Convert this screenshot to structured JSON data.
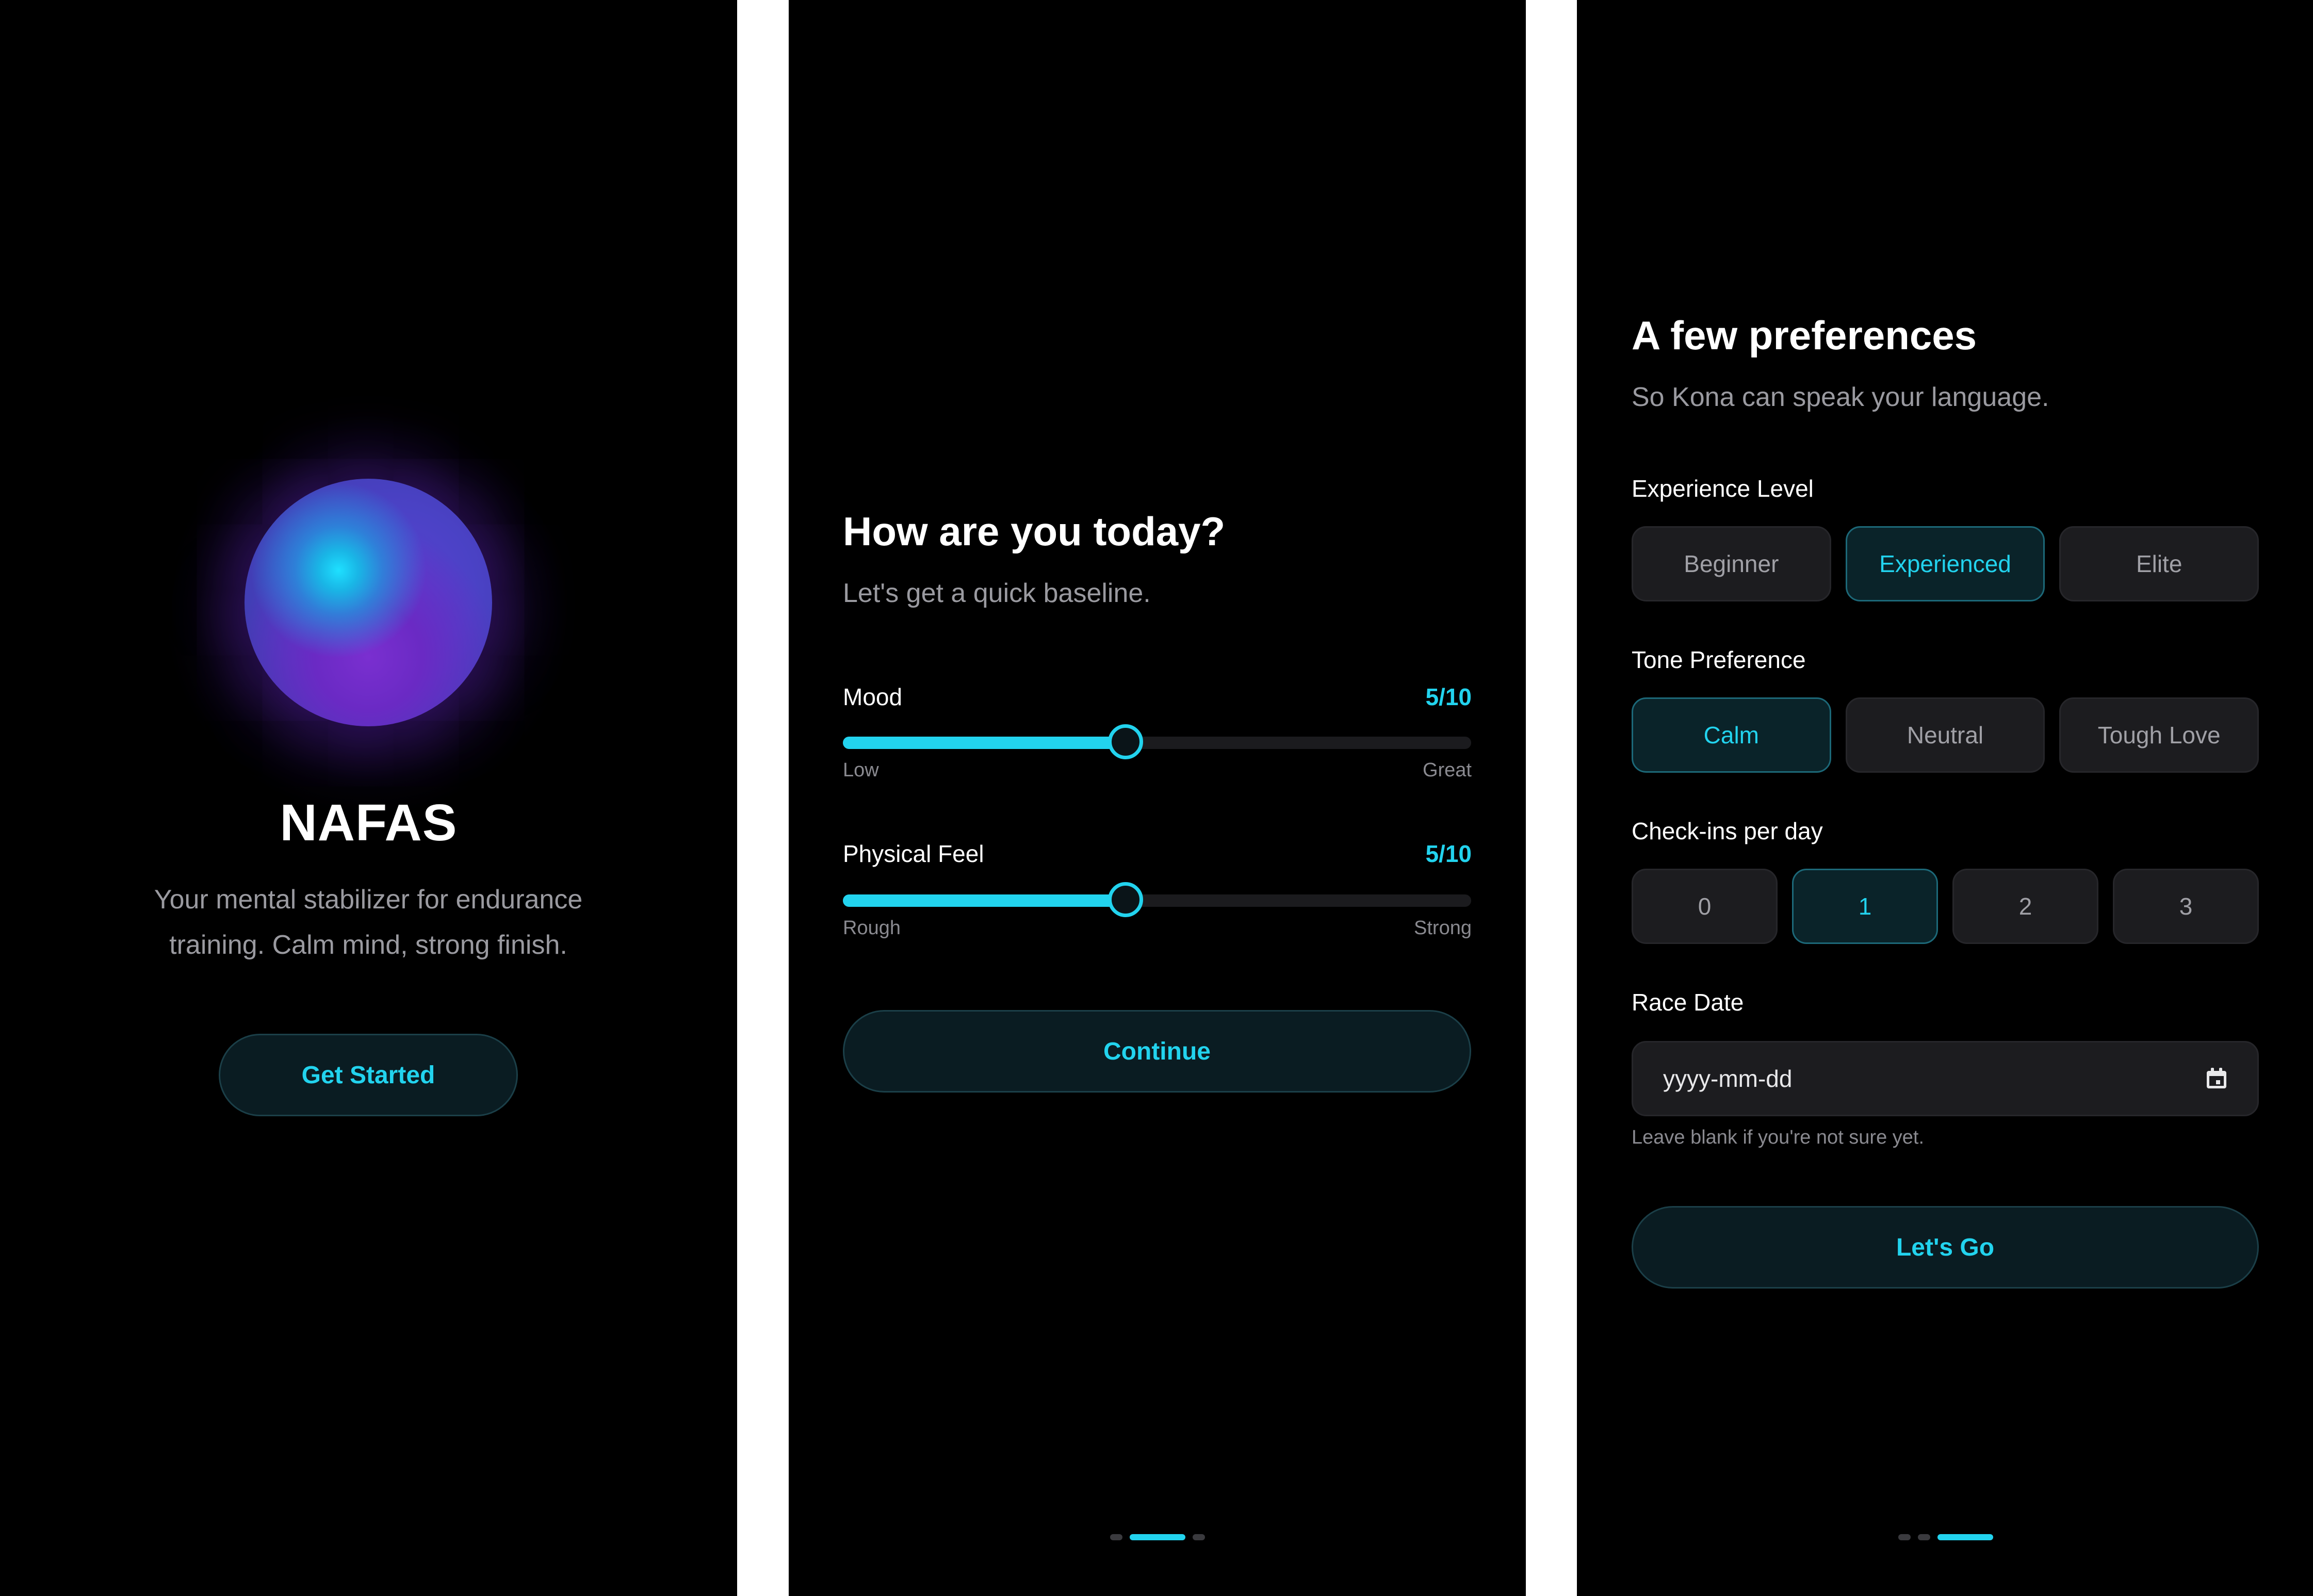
{
  "welcome": {
    "title": "NAFAS",
    "tagline_line1": "Your mental stabilizer for endurance",
    "tagline_line2": "training. Calm mind, strong finish.",
    "cta": "Get Started"
  },
  "baseline": {
    "title": "How are you today?",
    "subtitle": "Let's get a quick baseline.",
    "sliders": [
      {
        "label": "Mood",
        "value_text": "5/10",
        "value": 5,
        "max": 10,
        "min_label": "Low",
        "max_label": "Great"
      },
      {
        "label": "Physical Feel",
        "value_text": "5/10",
        "value": 5,
        "max": 10,
        "min_label": "Rough",
        "max_label": "Strong"
      }
    ],
    "cta": "Continue",
    "page_indicator": {
      "current": 2,
      "total": 3
    }
  },
  "preferences": {
    "title": "A few preferences",
    "subtitle": "So Kona can speak your language.",
    "experience": {
      "label": "Experience Level",
      "options": [
        "Beginner",
        "Experienced",
        "Elite"
      ],
      "selected": "Experienced"
    },
    "tone": {
      "label": "Tone Preference",
      "options": [
        "Calm",
        "Neutral",
        "Tough Love"
      ],
      "selected": "Calm"
    },
    "checkins": {
      "label": "Check-ins per day",
      "options": [
        "0",
        "1",
        "2",
        "3"
      ],
      "selected": "1"
    },
    "race_date": {
      "label": "Race Date",
      "placeholder": "yyyy-mm-dd",
      "hint": "Leave blank if you're not sure yet.",
      "icon": "calendar-icon"
    },
    "cta": "Let's Go",
    "page_indicator": {
      "current": 3,
      "total": 3
    }
  },
  "colors": {
    "accent": "#22d3ee",
    "background": "#000000",
    "button_bg": "#0a1c22",
    "muted_text": "#9a9aa0"
  }
}
